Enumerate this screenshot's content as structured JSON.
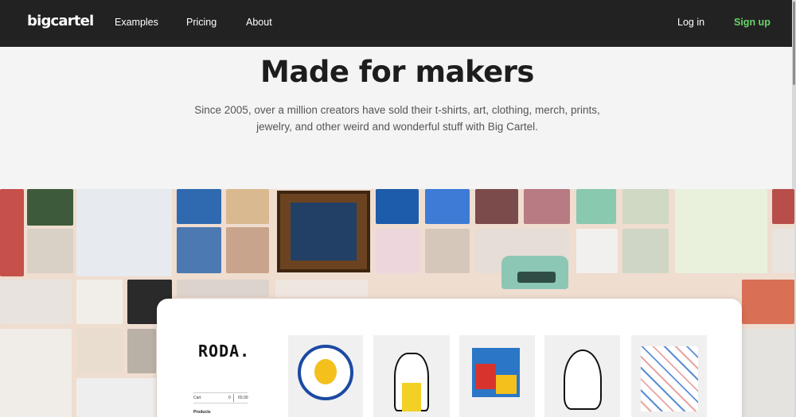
{
  "nav": {
    "logo": "bigcartel",
    "links": [
      "Examples",
      "Pricing",
      "About"
    ],
    "login": "Log in",
    "signup": "Sign up"
  },
  "hero": {
    "title": "Made for makers",
    "subtitle_line1": "Since 2005, over a million creators have sold their t-shirts, art, clothing, merch, prints,",
    "subtitle_line2": "jewelry, and other weird and wonderful stuff with Big Cartel."
  },
  "store_preview": {
    "store_name": "RODA.",
    "cart_label": "Cart",
    "cart_count": "0",
    "cart_total": "€0.00",
    "products_label": "Products"
  },
  "colors": {
    "nav_bg": "#222222",
    "signup": "#6ad46b",
    "page_bg": "#f4f4f4",
    "collage_bg": "#efddd0"
  }
}
